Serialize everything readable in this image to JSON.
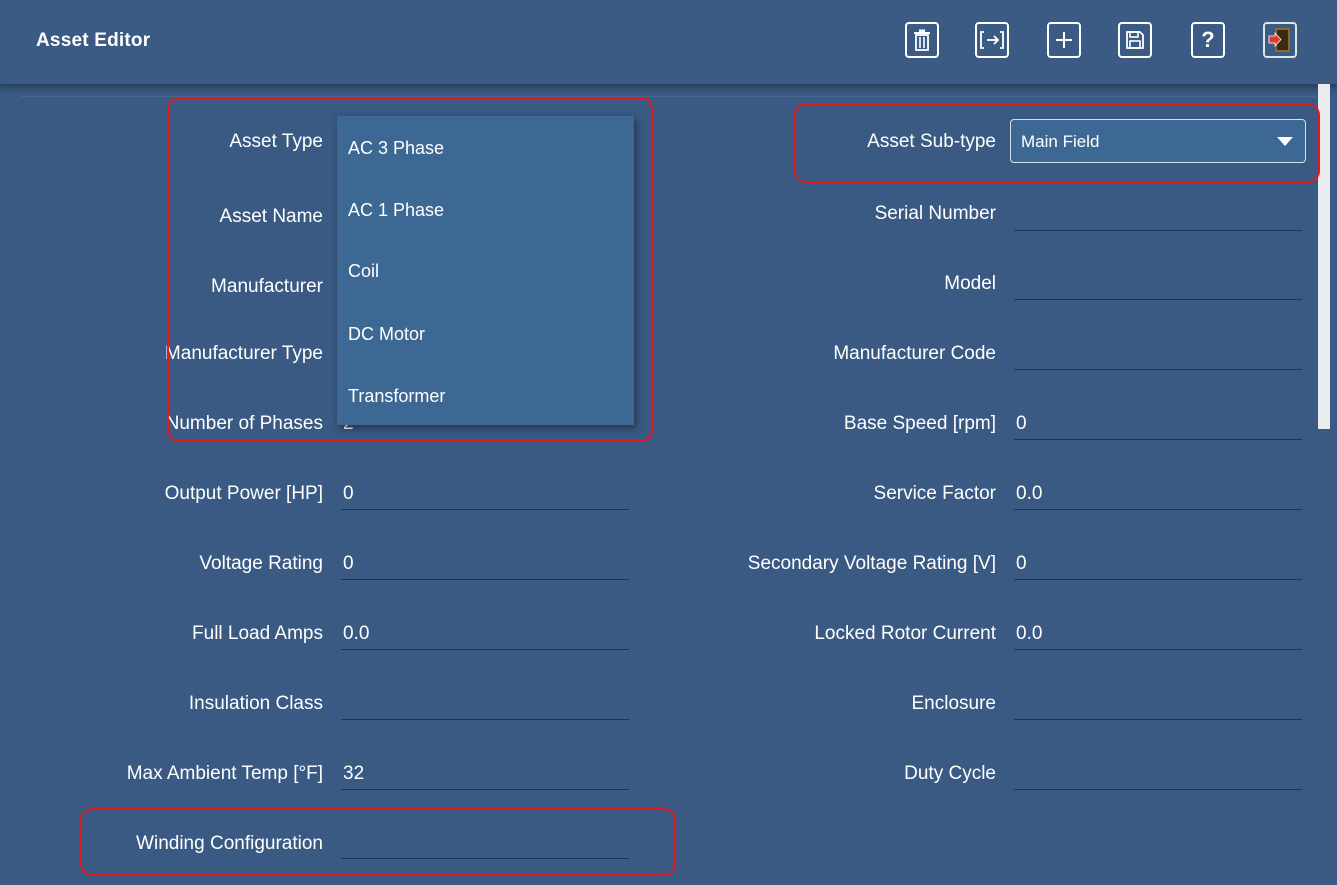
{
  "window": {
    "title": "Asset Editor"
  },
  "toolbar": [
    {
      "name": "delete",
      "icon": "trash-icon"
    },
    {
      "name": "export",
      "icon": "export-icon"
    },
    {
      "name": "add",
      "icon": "plus-icon"
    },
    {
      "name": "save",
      "icon": "save-icon"
    },
    {
      "name": "help",
      "icon": "help-icon",
      "glyph": "?"
    },
    {
      "name": "exit",
      "icon": "exit-door-icon"
    }
  ],
  "left_fields": [
    {
      "label": "Asset Type",
      "value": ""
    },
    {
      "label": "Asset Name",
      "value": ""
    },
    {
      "label": "Manufacturer",
      "value": ""
    },
    {
      "label": "Manufacturer Type",
      "value": ""
    },
    {
      "label": "Number of Phases",
      "value": "2"
    },
    {
      "label": "Output Power [HP]",
      "value": "0"
    },
    {
      "label": "Voltage Rating",
      "value": "0"
    },
    {
      "label": "Full Load Amps",
      "value": "0.0"
    },
    {
      "label": "Insulation Class",
      "value": ""
    },
    {
      "label": "Max Ambient Temp [°F]",
      "value": "32"
    },
    {
      "label": "Winding Configuration",
      "value": ""
    }
  ],
  "right_fields": [
    {
      "label": "Asset Sub-type",
      "value": "Main Field"
    },
    {
      "label": "Serial Number",
      "value": ""
    },
    {
      "label": "Model",
      "value": ""
    },
    {
      "label": "Manufacturer Code",
      "value": ""
    },
    {
      "label": "Base Speed [rpm]",
      "value": "0"
    },
    {
      "label": "Service Factor",
      "value": "0.0"
    },
    {
      "label": "Secondary Voltage Rating [V]",
      "value": "0"
    },
    {
      "label": "Locked Rotor Current",
      "value": "0.0"
    },
    {
      "label": "Enclosure",
      "value": ""
    },
    {
      "label": "Duty Cycle",
      "value": ""
    }
  ],
  "asset_type_dropdown": {
    "options": [
      "AC 3 Phase",
      "AC 1 Phase",
      "Coil",
      "DC Motor",
      "Transformer"
    ]
  },
  "colors": {
    "background": "#3a5a84",
    "dropdown": "#3e6894",
    "highlight": "#e0191e"
  }
}
